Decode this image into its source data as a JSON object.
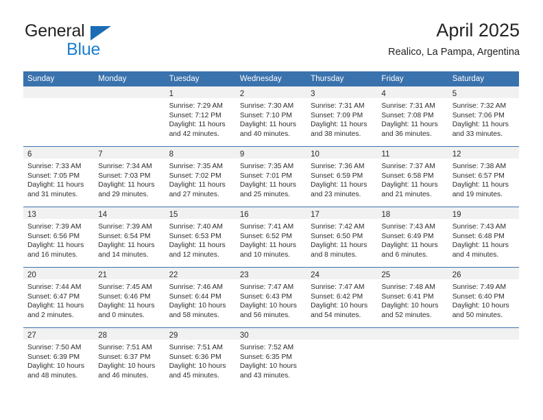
{
  "brand": {
    "name_top": "General",
    "name_bottom": "Blue",
    "triangle_color": "#1b6cb5",
    "blue_text_color": "#1b7ed0",
    "dark_text_color": "#231f20"
  },
  "header": {
    "title": "April 2025",
    "subtitle": "Realico, La Pampa, Argentina"
  },
  "theme": {
    "header_bg": "#3a72ad",
    "header_text": "#ffffff",
    "daynum_band_bg": "#f1f1f1",
    "row_separator": "#3a72ad",
    "cell_bg": "#ffffff",
    "body_text": "#2b2b2b"
  },
  "weekday_headers": [
    "Sunday",
    "Monday",
    "Tuesday",
    "Wednesday",
    "Thursday",
    "Friday",
    "Saturday"
  ],
  "weeks": [
    [
      {
        "day": "",
        "lines": []
      },
      {
        "day": "",
        "lines": []
      },
      {
        "day": "1",
        "lines": [
          "Sunrise: 7:29 AM",
          "Sunset: 7:12 PM",
          "Daylight: 11 hours",
          "and 42 minutes."
        ]
      },
      {
        "day": "2",
        "lines": [
          "Sunrise: 7:30 AM",
          "Sunset: 7:10 PM",
          "Daylight: 11 hours",
          "and 40 minutes."
        ]
      },
      {
        "day": "3",
        "lines": [
          "Sunrise: 7:31 AM",
          "Sunset: 7:09 PM",
          "Daylight: 11 hours",
          "and 38 minutes."
        ]
      },
      {
        "day": "4",
        "lines": [
          "Sunrise: 7:31 AM",
          "Sunset: 7:08 PM",
          "Daylight: 11 hours",
          "and 36 minutes."
        ]
      },
      {
        "day": "5",
        "lines": [
          "Sunrise: 7:32 AM",
          "Sunset: 7:06 PM",
          "Daylight: 11 hours",
          "and 33 minutes."
        ]
      }
    ],
    [
      {
        "day": "6",
        "lines": [
          "Sunrise: 7:33 AM",
          "Sunset: 7:05 PM",
          "Daylight: 11 hours",
          "and 31 minutes."
        ]
      },
      {
        "day": "7",
        "lines": [
          "Sunrise: 7:34 AM",
          "Sunset: 7:03 PM",
          "Daylight: 11 hours",
          "and 29 minutes."
        ]
      },
      {
        "day": "8",
        "lines": [
          "Sunrise: 7:35 AM",
          "Sunset: 7:02 PM",
          "Daylight: 11 hours",
          "and 27 minutes."
        ]
      },
      {
        "day": "9",
        "lines": [
          "Sunrise: 7:35 AM",
          "Sunset: 7:01 PM",
          "Daylight: 11 hours",
          "and 25 minutes."
        ]
      },
      {
        "day": "10",
        "lines": [
          "Sunrise: 7:36 AM",
          "Sunset: 6:59 PM",
          "Daylight: 11 hours",
          "and 23 minutes."
        ]
      },
      {
        "day": "11",
        "lines": [
          "Sunrise: 7:37 AM",
          "Sunset: 6:58 PM",
          "Daylight: 11 hours",
          "and 21 minutes."
        ]
      },
      {
        "day": "12",
        "lines": [
          "Sunrise: 7:38 AM",
          "Sunset: 6:57 PM",
          "Daylight: 11 hours",
          "and 19 minutes."
        ]
      }
    ],
    [
      {
        "day": "13",
        "lines": [
          "Sunrise: 7:39 AM",
          "Sunset: 6:56 PM",
          "Daylight: 11 hours",
          "and 16 minutes."
        ]
      },
      {
        "day": "14",
        "lines": [
          "Sunrise: 7:39 AM",
          "Sunset: 6:54 PM",
          "Daylight: 11 hours",
          "and 14 minutes."
        ]
      },
      {
        "day": "15",
        "lines": [
          "Sunrise: 7:40 AM",
          "Sunset: 6:53 PM",
          "Daylight: 11 hours",
          "and 12 minutes."
        ]
      },
      {
        "day": "16",
        "lines": [
          "Sunrise: 7:41 AM",
          "Sunset: 6:52 PM",
          "Daylight: 11 hours",
          "and 10 minutes."
        ]
      },
      {
        "day": "17",
        "lines": [
          "Sunrise: 7:42 AM",
          "Sunset: 6:50 PM",
          "Daylight: 11 hours",
          "and 8 minutes."
        ]
      },
      {
        "day": "18",
        "lines": [
          "Sunrise: 7:43 AM",
          "Sunset: 6:49 PM",
          "Daylight: 11 hours",
          "and 6 minutes."
        ]
      },
      {
        "day": "19",
        "lines": [
          "Sunrise: 7:43 AM",
          "Sunset: 6:48 PM",
          "Daylight: 11 hours",
          "and 4 minutes."
        ]
      }
    ],
    [
      {
        "day": "20",
        "lines": [
          "Sunrise: 7:44 AM",
          "Sunset: 6:47 PM",
          "Daylight: 11 hours",
          "and 2 minutes."
        ]
      },
      {
        "day": "21",
        "lines": [
          "Sunrise: 7:45 AM",
          "Sunset: 6:46 PM",
          "Daylight: 11 hours",
          "and 0 minutes."
        ]
      },
      {
        "day": "22",
        "lines": [
          "Sunrise: 7:46 AM",
          "Sunset: 6:44 PM",
          "Daylight: 10 hours",
          "and 58 minutes."
        ]
      },
      {
        "day": "23",
        "lines": [
          "Sunrise: 7:47 AM",
          "Sunset: 6:43 PM",
          "Daylight: 10 hours",
          "and 56 minutes."
        ]
      },
      {
        "day": "24",
        "lines": [
          "Sunrise: 7:47 AM",
          "Sunset: 6:42 PM",
          "Daylight: 10 hours",
          "and 54 minutes."
        ]
      },
      {
        "day": "25",
        "lines": [
          "Sunrise: 7:48 AM",
          "Sunset: 6:41 PM",
          "Daylight: 10 hours",
          "and 52 minutes."
        ]
      },
      {
        "day": "26",
        "lines": [
          "Sunrise: 7:49 AM",
          "Sunset: 6:40 PM",
          "Daylight: 10 hours",
          "and 50 minutes."
        ]
      }
    ],
    [
      {
        "day": "27",
        "lines": [
          "Sunrise: 7:50 AM",
          "Sunset: 6:39 PM",
          "Daylight: 10 hours",
          "and 48 minutes."
        ]
      },
      {
        "day": "28",
        "lines": [
          "Sunrise: 7:51 AM",
          "Sunset: 6:37 PM",
          "Daylight: 10 hours",
          "and 46 minutes."
        ]
      },
      {
        "day": "29",
        "lines": [
          "Sunrise: 7:51 AM",
          "Sunset: 6:36 PM",
          "Daylight: 10 hours",
          "and 45 minutes."
        ]
      },
      {
        "day": "30",
        "lines": [
          "Sunrise: 7:52 AM",
          "Sunset: 6:35 PM",
          "Daylight: 10 hours",
          "and 43 minutes."
        ]
      },
      {
        "day": "",
        "lines": []
      },
      {
        "day": "",
        "lines": []
      },
      {
        "day": "",
        "lines": []
      }
    ]
  ]
}
